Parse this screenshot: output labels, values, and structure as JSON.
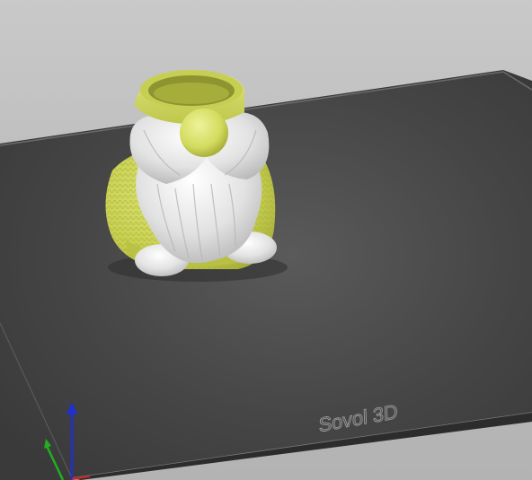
{
  "viewport": {
    "background_color": "#c2c2c2",
    "bed": {
      "surface_color": "#444444",
      "edge_color": "#6e6e6e",
      "logo_text": "Sovol 3D",
      "logo_color": "#8a8a8a"
    },
    "model": {
      "type": "gnome planter",
      "hat_color": "#d4dc6c",
      "body_color": "#cfd75a",
      "beard_color": "#e6e6e6",
      "nose_color": "#d9e06a"
    },
    "axes": {
      "x_color": "#d02020",
      "y_color": "#20b020",
      "z_color": "#1f2fd0"
    }
  }
}
